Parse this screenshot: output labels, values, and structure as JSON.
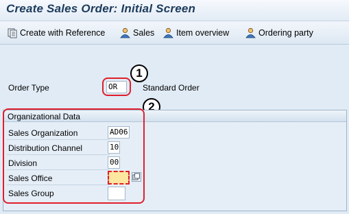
{
  "window": {
    "title": "Create Sales Order: Initial Screen"
  },
  "toolbar": {
    "create_ref": "Create with Reference",
    "sales": "Sales",
    "item_overview": "Item overview",
    "ordering_party": "Ordering party"
  },
  "header": {
    "order_type_label": "Order Type",
    "order_type_value": "OR",
    "order_type_desc": "Standard Order"
  },
  "org_data": {
    "title": "Organizational Data",
    "sales_org_label": "Sales Organization",
    "sales_org_value": "AD06",
    "dist_channel_label": "Distribution Channel",
    "dist_channel_value": "10",
    "division_label": "Division",
    "division_value": "00",
    "sales_office_label": "Sales Office",
    "sales_office_value": "",
    "sales_group_label": "Sales Group",
    "sales_group_value": ""
  },
  "callouts": {
    "one": "1",
    "two": "2"
  },
  "colors": {
    "highlight_red": "#e01e2b",
    "focused_field": "#fde7a0",
    "title_text": "#1d3b5c"
  },
  "icons": [
    "create-with-reference-icon",
    "sales-person-icon",
    "item-overview-person-icon",
    "ordering-party-person-icon",
    "f4-value-help-icon"
  ]
}
